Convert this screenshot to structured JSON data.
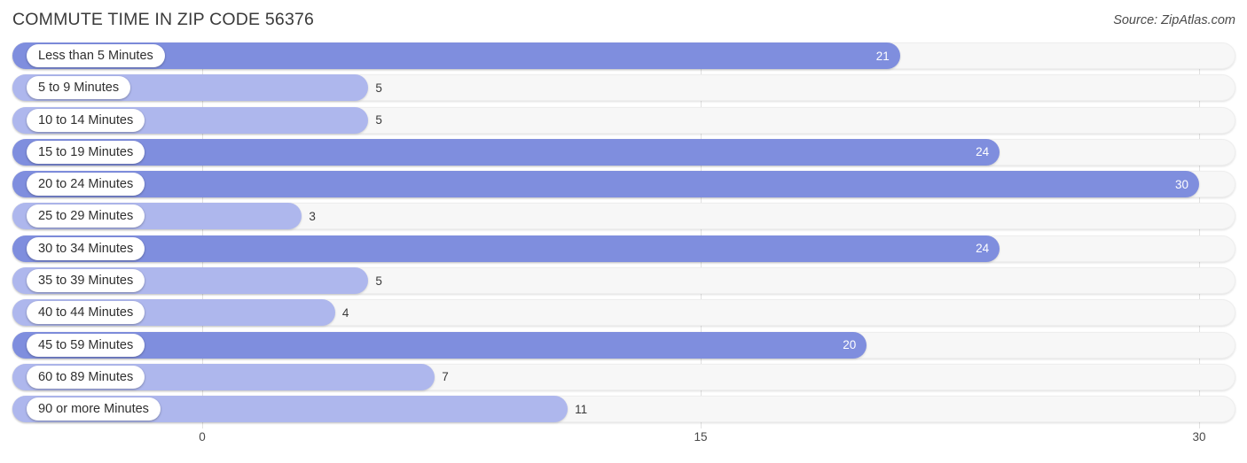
{
  "header": {
    "title": "COMMUTE TIME IN ZIP CODE 56376",
    "source": "Source: ZipAtlas.com"
  },
  "colors": {
    "bar_dark": "#7f8ede",
    "bar_light": "#aeb7ed",
    "track": "#f7f7f7",
    "gridline": "#e2e2e2",
    "label_text": "#2f2f2f"
  },
  "chart_data": {
    "type": "bar",
    "orientation": "horizontal",
    "title": "COMMUTE TIME IN ZIP CODE 56376",
    "xlabel": "",
    "ylabel": "",
    "xlim": [
      0,
      30
    ],
    "xticks": [
      0,
      15,
      30
    ],
    "xtick_labels": [
      "0",
      "15",
      "30"
    ],
    "grid": true,
    "legend": null,
    "source": "Source: ZipAtlas.com",
    "categories": [
      "Less than 5 Minutes",
      "5 to 9 Minutes",
      "10 to 14 Minutes",
      "15 to 19 Minutes",
      "20 to 24 Minutes",
      "25 to 29 Minutes",
      "30 to 34 Minutes",
      "35 to 39 Minutes",
      "40 to 44 Minutes",
      "45 to 59 Minutes",
      "60 to 89 Minutes",
      "90 or more Minutes"
    ],
    "values": [
      21,
      5,
      5,
      24,
      30,
      3,
      24,
      5,
      4,
      20,
      7,
      11
    ],
    "value_labels": [
      "21",
      "5",
      "5",
      "24",
      "30",
      "3",
      "24",
      "5",
      "4",
      "20",
      "7",
      "11"
    ]
  },
  "rows": [
    {
      "label": "Less than 5 Minutes",
      "value": 21,
      "value_label": "21",
      "shade": "dark",
      "label_pos": "inside"
    },
    {
      "label": "5 to 9 Minutes",
      "value": 5,
      "value_label": "5",
      "shade": "light",
      "label_pos": "outside"
    },
    {
      "label": "10 to 14 Minutes",
      "value": 5,
      "value_label": "5",
      "shade": "light",
      "label_pos": "outside"
    },
    {
      "label": "15 to 19 Minutes",
      "value": 24,
      "value_label": "24",
      "shade": "dark",
      "label_pos": "inside"
    },
    {
      "label": "20 to 24 Minutes",
      "value": 30,
      "value_label": "30",
      "shade": "dark",
      "label_pos": "inside"
    },
    {
      "label": "25 to 29 Minutes",
      "value": 3,
      "value_label": "3",
      "shade": "light",
      "label_pos": "outside"
    },
    {
      "label": "30 to 34 Minutes",
      "value": 24,
      "value_label": "24",
      "shade": "dark",
      "label_pos": "inside"
    },
    {
      "label": "35 to 39 Minutes",
      "value": 5,
      "value_label": "5",
      "shade": "light",
      "label_pos": "outside"
    },
    {
      "label": "40 to 44 Minutes",
      "value": 4,
      "value_label": "4",
      "shade": "light",
      "label_pos": "outside"
    },
    {
      "label": "45 to 59 Minutes",
      "value": 20,
      "value_label": "20",
      "shade": "dark",
      "label_pos": "inside"
    },
    {
      "label": "60 to 89 Minutes",
      "value": 7,
      "value_label": "7",
      "shade": "light",
      "label_pos": "outside"
    },
    {
      "label": "90 or more Minutes",
      "value": 11,
      "value_label": "11",
      "shade": "light",
      "label_pos": "outside"
    }
  ],
  "axis": {
    "ticks": [
      {
        "label": "0",
        "value": 0
      },
      {
        "label": "15",
        "value": 15
      },
      {
        "label": "30",
        "value": 30
      }
    ]
  }
}
